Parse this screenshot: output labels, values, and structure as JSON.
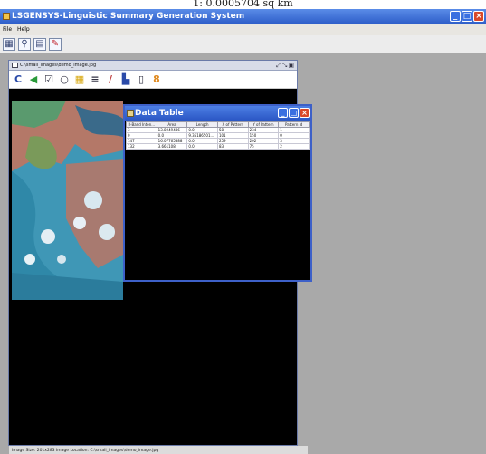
{
  "caption": "1: 0.0005704 sq km",
  "app": {
    "title": "LSGENSYS-Linguistic Summary Generation System",
    "menu": [
      "File",
      "Help"
    ],
    "toolbar_icons": [
      "table-icon",
      "search-icon",
      "document-icon",
      "pin-icon"
    ]
  },
  "image_window": {
    "title": "C:\\small_images\\demo_image.jpg",
    "tools": [
      "C",
      "◀",
      "☑",
      "○",
      "▦",
      "≡",
      "/",
      "▙",
      "▯",
      "8"
    ],
    "status": "Image Size: 201x283    Image Location: C:\\small_images\\demo_image.jpg"
  },
  "data_table": {
    "title": "Data Table",
    "columns": [
      "R-Band Inten...",
      "Area",
      "Length",
      "X of Pattern",
      "Y of Pattern",
      "Pattern id"
    ],
    "rows": [
      [
        "3",
        "13.8949486",
        "0.0",
        "58",
        "234",
        "1"
      ],
      [
        "0",
        "0.0",
        "9.35186501...",
        "101",
        "150",
        "0"
      ],
      [
        "147",
        "16.07765888",
        "0.0",
        "259",
        "202",
        "3"
      ],
      [
        "132",
        "3.661108",
        "0.0",
        "83",
        "75",
        "2"
      ]
    ]
  },
  "colors": {
    "titlebar": "#2f5fc9",
    "window_bg": "#a9a9a9",
    "canvas": "#000000"
  }
}
